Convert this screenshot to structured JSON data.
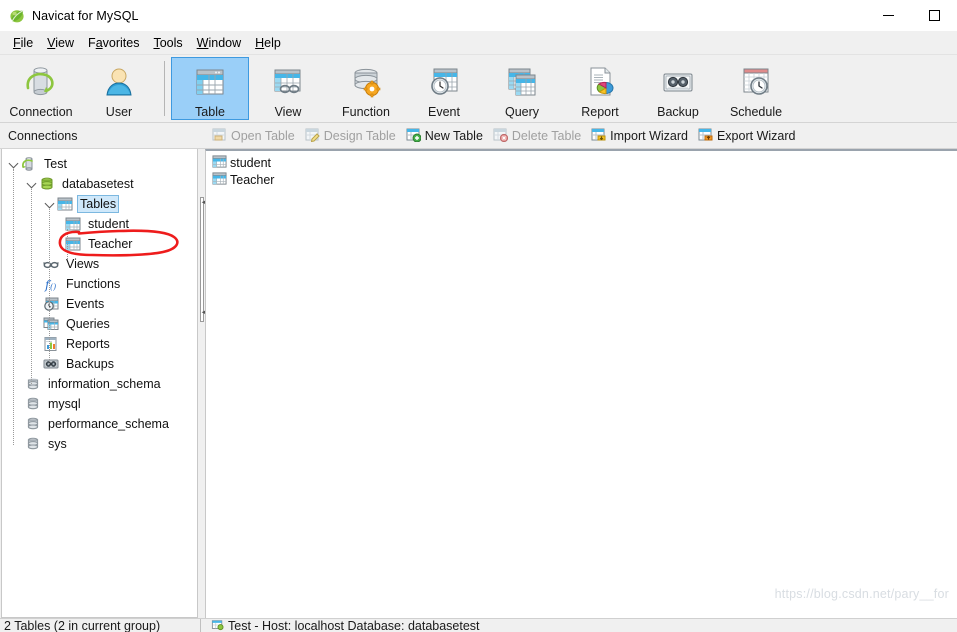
{
  "window": {
    "title": "Navicat for MySQL",
    "app_icon": "navicat-leaf-icon",
    "minimize_label": "Minimize",
    "maximize_label": "Maximize"
  },
  "menubar": {
    "items": [
      {
        "label": "File",
        "mnemonic": "F",
        "rest": "ile"
      },
      {
        "label": "View",
        "mnemonic": "V",
        "rest": "iew"
      },
      {
        "label": "Favorites",
        "mnemonic": "F",
        "pre": "F",
        "rest": "avorites"
      },
      {
        "label": "Tools",
        "mnemonic": "T",
        "rest": "ools"
      },
      {
        "label": "Window",
        "mnemonic": "W",
        "rest": "indow"
      },
      {
        "label": "Help",
        "mnemonic": "H",
        "rest": "elp"
      }
    ]
  },
  "toolbar": {
    "groups": [
      {
        "buttons": [
          {
            "label": "Connection",
            "icon": "connection-icon",
            "active": false
          },
          {
            "label": "User",
            "icon": "user-icon",
            "active": false
          }
        ]
      },
      {
        "buttons": [
          {
            "label": "Table",
            "icon": "table-icon",
            "active": true
          },
          {
            "label": "View",
            "icon": "view-icon",
            "active": false
          },
          {
            "label": "Function",
            "icon": "function-icon",
            "active": false
          },
          {
            "label": "Event",
            "icon": "event-icon",
            "active": false
          },
          {
            "label": "Query",
            "icon": "query-icon",
            "active": false
          },
          {
            "label": "Report",
            "icon": "report-icon",
            "active": false
          },
          {
            "label": "Backup",
            "icon": "backup-icon",
            "active": false
          },
          {
            "label": "Schedule",
            "icon": "schedule-icon",
            "active": false
          }
        ]
      }
    ]
  },
  "panels": {
    "connections_header": "Connections"
  },
  "actionbar": {
    "items": [
      {
        "label": "Open Table",
        "icon": "open-table-icon",
        "disabled": true
      },
      {
        "label": "Design Table",
        "icon": "design-table-icon",
        "disabled": true
      },
      {
        "label": "New Table",
        "icon": "new-table-icon",
        "disabled": false
      },
      {
        "label": "Delete Table",
        "icon": "delete-table-icon",
        "disabled": true
      },
      {
        "label": "Import Wizard",
        "icon": "import-wizard-icon",
        "disabled": false
      },
      {
        "label": "Export Wizard",
        "icon": "export-wizard-icon",
        "disabled": false
      }
    ]
  },
  "tree": {
    "nodes": [
      {
        "label": "Test",
        "icon": "connection-node-icon",
        "depth": 0,
        "expanded": true,
        "selected": false
      },
      {
        "label": "databasetest",
        "icon": "database-icon",
        "depth": 1,
        "expanded": true,
        "selected": false
      },
      {
        "label": "Tables",
        "icon": "tables-icon",
        "depth": 2,
        "expanded": true,
        "selected": true
      },
      {
        "label": "student",
        "icon": "table-node-icon",
        "depth": 3,
        "expanded": null,
        "selected": false
      },
      {
        "label": "Teacher",
        "icon": "table-node-icon",
        "depth": 3,
        "expanded": null,
        "selected": false,
        "annotated": true
      },
      {
        "label": "Views",
        "icon": "views-icon",
        "depth": 2,
        "expanded": null,
        "selected": false
      },
      {
        "label": "Functions",
        "icon": "functions-icon",
        "depth": 2,
        "expanded": null,
        "selected": false
      },
      {
        "label": "Events",
        "icon": "events-icon",
        "depth": 2,
        "expanded": null,
        "selected": false
      },
      {
        "label": "Queries",
        "icon": "queries-icon",
        "depth": 2,
        "expanded": null,
        "selected": false
      },
      {
        "label": "Reports",
        "icon": "reports-icon",
        "depth": 2,
        "expanded": null,
        "selected": false
      },
      {
        "label": "Backups",
        "icon": "backups-icon",
        "depth": 2,
        "expanded": null,
        "selected": false
      },
      {
        "label": "information_schema",
        "icon": "database-gray-icon",
        "depth": 1,
        "expanded": null,
        "selected": false
      },
      {
        "label": "mysql",
        "icon": "database-gray-icon",
        "depth": 1,
        "expanded": null,
        "selected": false
      },
      {
        "label": "performance_schema",
        "icon": "database-gray-icon",
        "depth": 1,
        "expanded": null,
        "selected": false
      },
      {
        "label": "sys",
        "icon": "database-gray-icon",
        "depth": 1,
        "expanded": null,
        "selected": false
      }
    ]
  },
  "content": {
    "items": [
      {
        "label": "student",
        "icon": "table-node-icon"
      },
      {
        "label": "Teacher",
        "icon": "table-node-icon"
      }
    ]
  },
  "statusbar": {
    "left": "2 Tables (2 in current group)",
    "right": "Test - Host: localhost Database: databasetest",
    "right_icon": "server-status-icon"
  },
  "watermark": {
    "text": "https://blog.csdn.net/pary__for"
  },
  "colors": {
    "accent_selected": "#9acff8",
    "accent_border": "#3e9ae0",
    "annotation_red": "#ee1c1c",
    "window_bg": "#f0f0f0",
    "panel_bg": "#ffffff"
  }
}
